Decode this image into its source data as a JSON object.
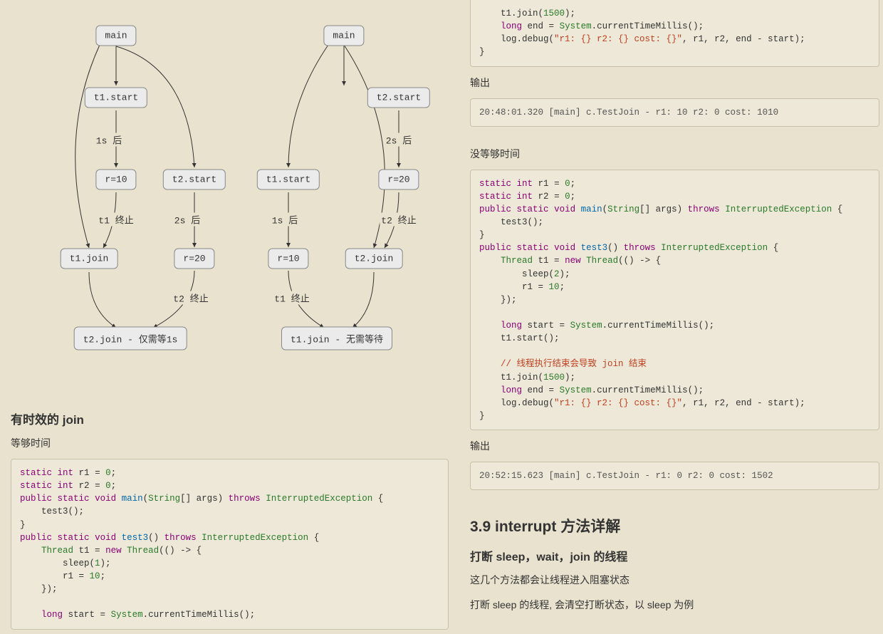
{
  "diagram": {
    "nodes": {
      "l_main": "main",
      "l_t1start": "t1.start",
      "l_r10": "r=10",
      "l_t2start": "t2.start",
      "l_r20": "r=20",
      "l_t1join": "t1.join",
      "l_t2join": "t2.join - 仅需等1s",
      "r_main": "main",
      "r_t2start": "t2.start",
      "r_r20": "r=20",
      "r_t1start": "t1.start",
      "r_r10": "r=10",
      "r_t2join": "t2.join",
      "r_t1join": "t1.join - 无需等待"
    },
    "labels": {
      "l_1s": "1s 后",
      "l_t1end": "t1 终止",
      "l_2s": "2s 后",
      "l_t2end": "t2 终止",
      "r_2s": "2s 后",
      "r_t2end": "t2 终止",
      "r_1s": "1s 后",
      "r_t1end": "t1 终止"
    }
  },
  "left": {
    "heading_timed_join": "有时效的 join",
    "label_enough_time": "等够时间",
    "code1_html": "<span class=\"kw1\">static</span> <span class=\"kw2\">int</span> r1 <span class=\"op\">=</span> <span class=\"num\">0</span>;\n<span class=\"kw1\">static</span> <span class=\"kw2\">int</span> r2 <span class=\"op\">=</span> <span class=\"num\">0</span>;\n<span class=\"kw1\">public</span> <span class=\"kw1\">static</span> <span class=\"kw1\">void</span> <span class=\"fn\">main</span>(<span class=\"cls\">String</span>[] args) <span class=\"kw1\">throws</span> <span class=\"cls\">InterruptedException</span> {\n    test3();\n}\n<span class=\"kw1\">public</span> <span class=\"kw1\">static</span> <span class=\"kw1\">void</span> <span class=\"fn\">test3</span>() <span class=\"kw1\">throws</span> <span class=\"cls\">InterruptedException</span> {\n    <span class=\"cls\">Thread</span> t1 <span class=\"op\">=</span> <span class=\"kw1\">new</span> <span class=\"cls\">Thread</span>(() <span class=\"op\">-&gt;</span> {\n        sleep(<span class=\"num\">1</span>);\n        r1 <span class=\"op\">=</span> <span class=\"num\">10</span>;\n    });\n\n    <span class=\"kw2\">long</span> start <span class=\"op\">=</span> <span class=\"cls\">System</span>.currentTimeMillis();\n"
  },
  "right": {
    "code0_html": "    t1.join(<span class=\"num\">1500</span>);\n    <span class=\"kw2\">long</span> end <span class=\"op\">=</span> <span class=\"cls\">System</span>.currentTimeMillis();\n    log.debug(<span class=\"str\">\"r1: {} r2: {} cost: {}\"</span>, r1, r2, end <span class=\"op\">-</span> start);\n}",
    "label_output1": "输出",
    "output1": "20:48:01.320 [main] c.TestJoin - r1: 10 r2: 0 cost: 1010",
    "label_not_enough": "没等够时间",
    "code2_html": "<span class=\"kw1\">static</span> <span class=\"kw2\">int</span> r1 <span class=\"op\">=</span> <span class=\"num\">0</span>;\n<span class=\"kw1\">static</span> <span class=\"kw2\">int</span> r2 <span class=\"op\">=</span> <span class=\"num\">0</span>;\n<span class=\"kw1\">public</span> <span class=\"kw1\">static</span> <span class=\"kw1\">void</span> <span class=\"fn\">main</span>(<span class=\"cls\">String</span>[] args) <span class=\"kw1\">throws</span> <span class=\"cls\">InterruptedException</span> {\n    test3();\n}\n<span class=\"kw1\">public</span> <span class=\"kw1\">static</span> <span class=\"kw1\">void</span> <span class=\"fn\">test3</span>() <span class=\"kw1\">throws</span> <span class=\"cls\">InterruptedException</span> {\n    <span class=\"cls\">Thread</span> t1 <span class=\"op\">=</span> <span class=\"kw1\">new</span> <span class=\"cls\">Thread</span>(() <span class=\"op\">-&gt;</span> {\n        sleep(<span class=\"num\">2</span>);\n        r1 <span class=\"op\">=</span> <span class=\"num\">10</span>;\n    });\n\n    <span class=\"kw2\">long</span> start <span class=\"op\">=</span> <span class=\"cls\">System</span>.currentTimeMillis();\n    t1.start();\n\n    <span class=\"cmt\">// 线程执行结束会导致 join 结束</span>\n    t1.join(<span class=\"num\">1500</span>);\n    <span class=\"kw2\">long</span> end <span class=\"op\">=</span> <span class=\"cls\">System</span>.currentTimeMillis();\n    log.debug(<span class=\"str\">\"r1: {} r2: {} cost: {}\"</span>, r1, r2, end <span class=\"op\">-</span> start);\n}",
    "label_output2": "输出",
    "output2": "20:52:15.623 [main] c.TestJoin - r1: 0 r2: 0 cost: 1502",
    "heading_39": "3.9 interrupt 方法详解",
    "heading_break": "打断 sleep，wait，join 的线程",
    "p1": "这几个方法都会让线程进入阻塞状态",
    "p2": "打断 sleep 的线程, 会清空打断状态，以 sleep 为例"
  }
}
